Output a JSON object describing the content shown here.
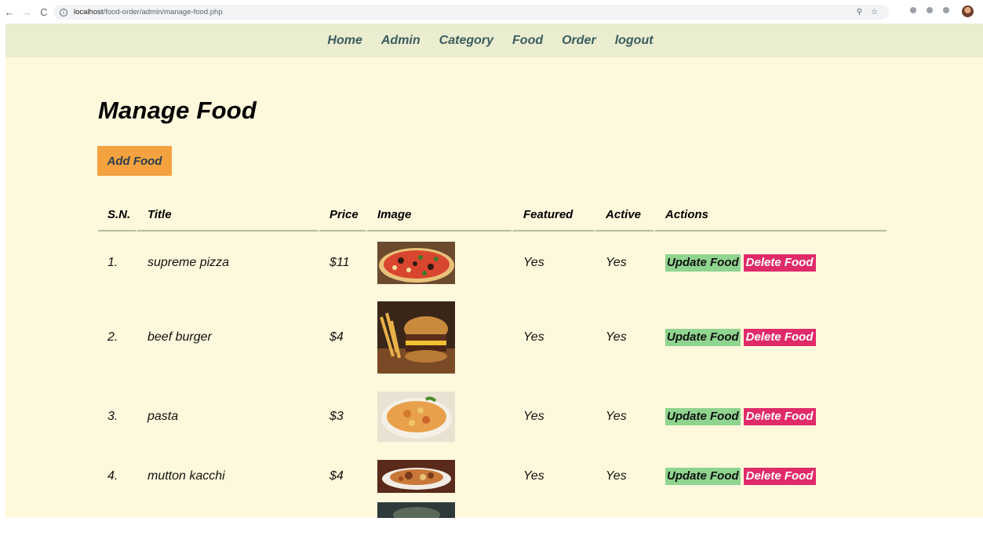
{
  "browser": {
    "url_host": "localhost",
    "url_path": "/food-order/admin/manage-food.php"
  },
  "nav": {
    "items": [
      "Home",
      "Admin",
      "Category",
      "Food",
      "Order",
      "logout"
    ]
  },
  "page": {
    "title": "Manage Food",
    "add_button": "Add Food"
  },
  "table": {
    "headers": [
      "S.N.",
      "Title",
      "Price",
      "Image",
      "Featured",
      "Active",
      "Actions"
    ],
    "rows": [
      {
        "sn": "1.",
        "title": "supreme pizza",
        "price": "$11",
        "featured": "Yes",
        "active": "Yes",
        "image_icon": "pizza-image"
      },
      {
        "sn": "2.",
        "title": "beef burger",
        "price": "$4",
        "featured": "Yes",
        "active": "Yes",
        "image_icon": "burger-image"
      },
      {
        "sn": "3.",
        "title": "pasta",
        "price": "$3",
        "featured": "Yes",
        "active": "Yes",
        "image_icon": "pasta-image"
      },
      {
        "sn": "4.",
        "title": "mutton kacchi",
        "price": "$4",
        "featured": "Yes",
        "active": "Yes",
        "image_icon": "kacchi-image"
      }
    ],
    "update_label": "Update Food",
    "delete_label": "Delete Food"
  },
  "colors": {
    "page_bg": "#fef8dc",
    "nav_bg": "#eaedd0",
    "add_button": "#f3a23f",
    "update_button": "#8fd48f",
    "delete_button": "#e02a6a"
  }
}
